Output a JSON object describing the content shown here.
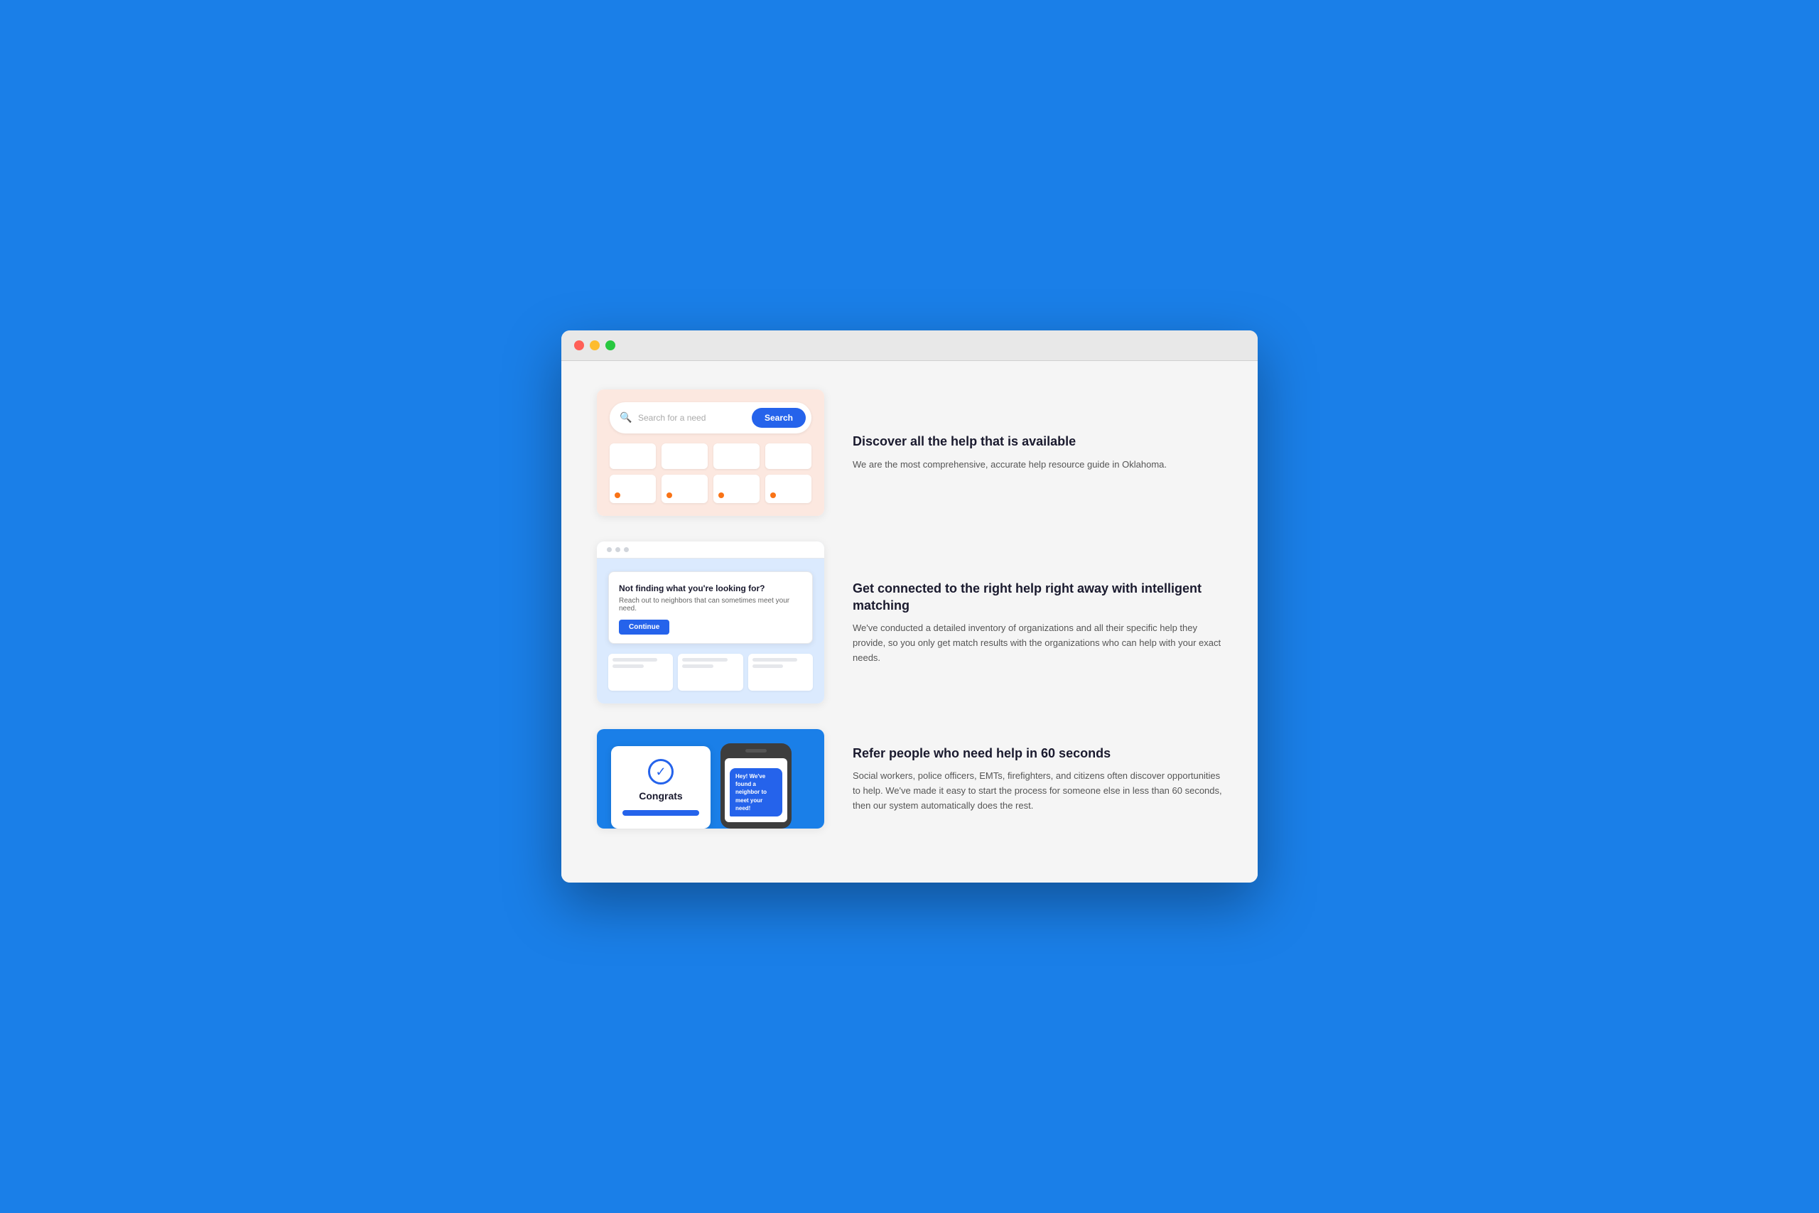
{
  "browser": {
    "traffic_lights": [
      "red",
      "yellow",
      "green"
    ]
  },
  "features": [
    {
      "id": "search",
      "heading": "Discover all the help that is available",
      "description": "We are the most comprehensive, accurate help resource guide in Oklahoma.",
      "search_placeholder": "Search for a need",
      "search_button": "Search"
    },
    {
      "id": "matching",
      "heading": "Get connected to the right help right away with intelligent matching",
      "description": "We've conducted a detailed inventory of organizations and all their specific help they provide, so you only get match results with the organizations who can help with your exact needs.",
      "modal_title": "Not finding what you're looking for?",
      "modal_subtitle": "Reach out to neighbors that can sometimes meet your need.",
      "modal_button": "Continue"
    },
    {
      "id": "refer",
      "heading": "Refer people who need help in 60 seconds",
      "description": "Social workers, police officers, EMTs, firefighters, and citizens often discover opportunities to help. We've made it easy to start the process for someone else in less than 60 seconds, then our system automatically does the rest.",
      "congrats_text": "Congrats",
      "chat_bubble": "Hey! We've found a neighbor to meet your need!"
    }
  ]
}
